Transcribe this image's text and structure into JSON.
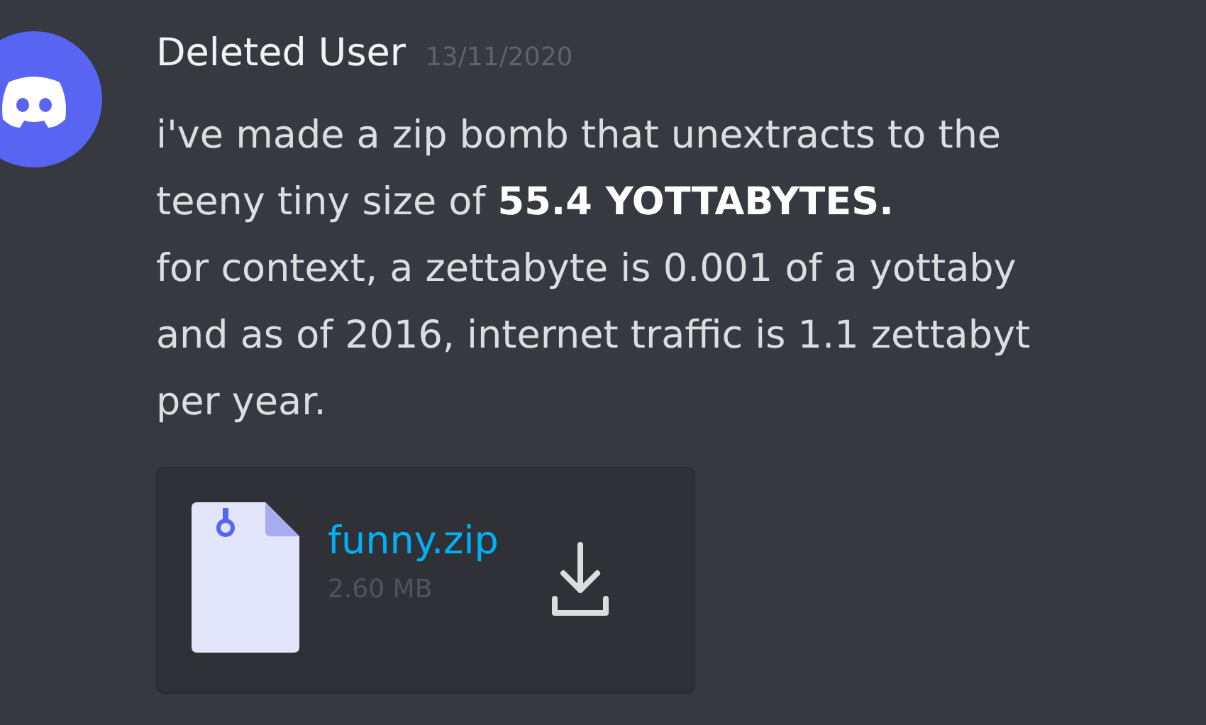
{
  "message": {
    "author": "Deleted User",
    "timestamp": "13/11/2020",
    "lines": [
      "i've made a zip bomb that unextracts to the",
      "teeny tiny size of **55.4 YOTTABYTES.**",
      "for context, a zettabyte is 0.001 of a yottaby",
      "and as of 2016, internet traffic is 1.1 zettabyt",
      "per year."
    ],
    "attachment": {
      "filename": "funny.zip",
      "size": "2.60 MB"
    }
  }
}
